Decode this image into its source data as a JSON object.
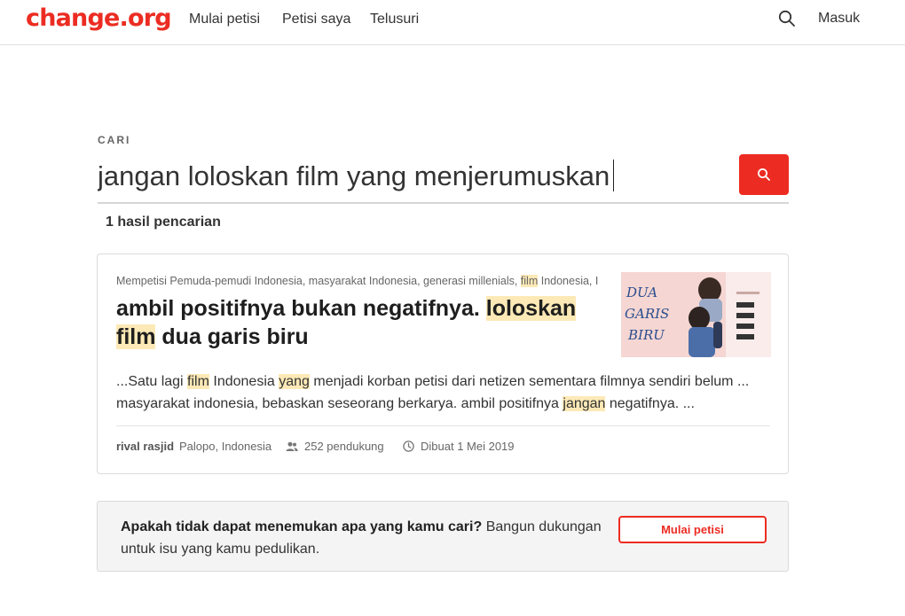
{
  "header": {
    "logo": "change.org",
    "nav": [
      "Mulai petisi",
      "Petisi saya",
      "Telusuri"
    ],
    "login": "Masuk"
  },
  "search": {
    "label": "CARI",
    "query": "jangan loloskan film yang menjerumuskan",
    "result_count": "1 hasil pencarian"
  },
  "result": {
    "targets_prefix": "Mempetisi Pemuda-pemudi Indonesia, masyarakat Indonesia, generasi millenials, ",
    "targets_hl": "film",
    "targets_suffix": " Indonesia, I",
    "title_part1": "ambil positifnya bukan negatifnya. ",
    "title_hl1": "loloskan",
    "title_hl2": "film",
    "title_part2": " dua garis biru",
    "excerpt_1": "...Satu lagi ",
    "excerpt_hl1": "film",
    "excerpt_2": " Indonesia ",
    "excerpt_hl2": "yang",
    "excerpt_3": " menjadi korban petisi dari netizen sementara filmnya sendiri belum ... masyarakat indonesia, bebaskan seseorang berkarya. ambil positifnya ",
    "excerpt_hl3": "jangan",
    "excerpt_4": " negatifnya. ...",
    "thumbnail_text": [
      "DUA",
      "GARIS",
      "BIRU"
    ],
    "author": "rival rasjid",
    "location": "Palopo, Indonesia",
    "supporters": "252 pendukung",
    "created": "Dibuat 1 Mei 2019"
  },
  "cta": {
    "bold": "Apakah tidak dapat menemukan apa yang kamu cari?",
    "text": " Bangun dukungan untuk isu yang kamu pedulikan.",
    "button": "Mulai petisi"
  },
  "colors": {
    "brand": "#ec2c22",
    "highlight": "#fde9b6"
  }
}
